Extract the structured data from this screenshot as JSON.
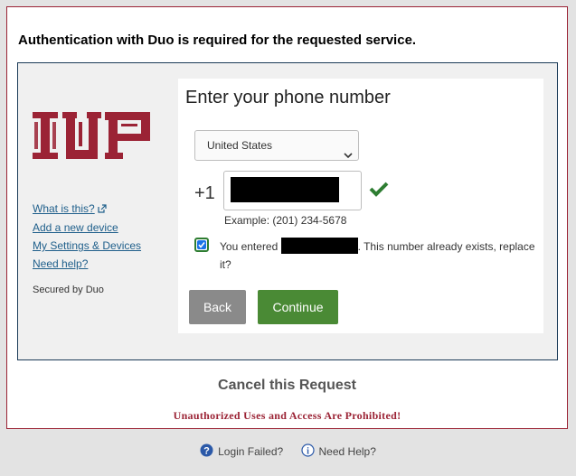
{
  "page": {
    "heading": "Authentication with Duo is required for the requested service."
  },
  "brand": {
    "logo_text": "IUP",
    "color": "#9b2335"
  },
  "sidebar": {
    "links": [
      {
        "label": "What is this?",
        "icon": "external-link-icon"
      },
      {
        "label": "Add a new device"
      },
      {
        "label": "My Settings & Devices"
      },
      {
        "label": "Need help?"
      }
    ],
    "secured_by": "Secured by Duo"
  },
  "form": {
    "title": "Enter your phone number",
    "country": {
      "selected": "United States"
    },
    "phone": {
      "prefix": "+1",
      "value_redacted": true,
      "valid_icon": "checkmark-icon"
    },
    "example": "Example: (201) 234-5678",
    "confirm": {
      "checked": true,
      "text_before": "You entered",
      "text_after": ". This number already exists, replace it?"
    },
    "buttons": {
      "back": "Back",
      "continue": "Continue"
    }
  },
  "cancel_label": "Cancel this Request",
  "warning": "Unauthorized Uses and Access Are Prohibited!",
  "footer": {
    "login_failed": "Login Failed?",
    "need_help": "Need Help?"
  },
  "colors": {
    "accent_green": "#4a8a35",
    "link_blue": "#1f5f8b",
    "check_green": "#2e7d32"
  }
}
